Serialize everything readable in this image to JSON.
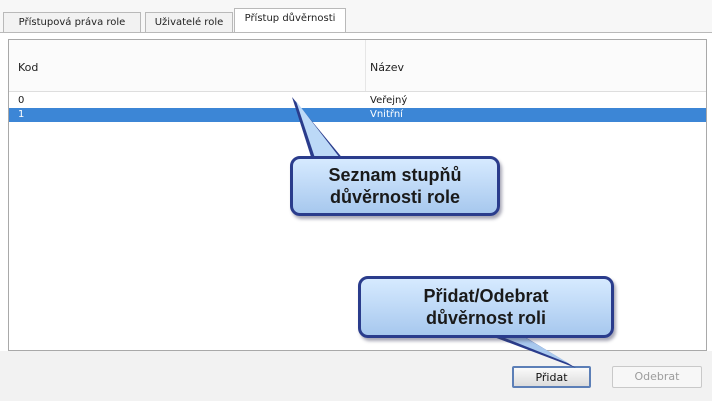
{
  "tabs": [
    {
      "label": "Přístupová práva role",
      "active": false
    },
    {
      "label": "Uživatelé role",
      "active": false
    },
    {
      "label": "Přístup důvěrnosti",
      "active": true
    }
  ],
  "table": {
    "columns": [
      "Kod",
      "Název"
    ],
    "rows": [
      {
        "kod": "0",
        "nazev": "Veřejný",
        "selected": false
      },
      {
        "kod": "1",
        "nazev": "Vnitřní",
        "selected": true
      }
    ]
  },
  "callouts": {
    "list": {
      "line1": "Seznam stupňů",
      "line2": "důvěrnosti role"
    },
    "buttons": {
      "line1": "Přidat/Odebrat",
      "line2": "důvěrnost roli"
    }
  },
  "footer": {
    "add_label": "Přidat",
    "remove_label": "Odebrat"
  },
  "colors": {
    "selection": "#3c86d6",
    "callout_border": "#2a3c8c",
    "callout_fill": "#bcd9f7"
  }
}
